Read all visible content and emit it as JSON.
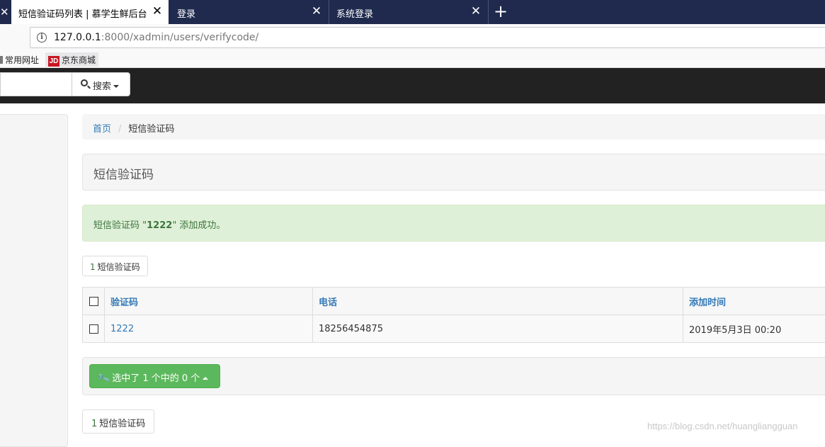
{
  "browser": {
    "tabs": [
      {
        "title": "短信验证码列表 | 慕学生鲜后台",
        "active": true
      },
      {
        "title": "登录",
        "active": false
      },
      {
        "title": "系统登录",
        "active": false
      }
    ],
    "close_glyph": "✕",
    "new_tab_glyph": "+",
    "url_host": "127.0.0.1",
    "url_rest": ":8000/xadmin/users/verifycode/",
    "bookmarks": [
      {
        "label": "常用网址",
        "icon": "folder-icon"
      },
      {
        "label": "京东商城",
        "icon": "jd-icon",
        "icon_text": "JD"
      }
    ]
  },
  "header": {
    "search_button_label": "搜索",
    "search_icon": "magnifier-icon"
  },
  "breadcrumb": {
    "home": "首页",
    "separator": "/",
    "current": "短信验证码"
  },
  "page": {
    "title": "短信验证码"
  },
  "alert": {
    "prefix": "短信验证码 \"",
    "value": "1222",
    "suffix": "\" 添加成功。",
    "color": "#dff0d8"
  },
  "result_count": {
    "num": "1",
    "label": "短信验证码"
  },
  "table": {
    "columns": [
      "验证码",
      "电话",
      "添加时间"
    ],
    "rows": [
      {
        "code": "1222",
        "mobile": "18256454875",
        "add_time": "2019年5月3日 00:20"
      }
    ]
  },
  "actions": {
    "selected_label": "选中了 1 个中的 0 个",
    "icon": "wrench-icon",
    "color": "#5cb85c"
  },
  "watermark": "https://blog.csdn.net/huangliangguan"
}
